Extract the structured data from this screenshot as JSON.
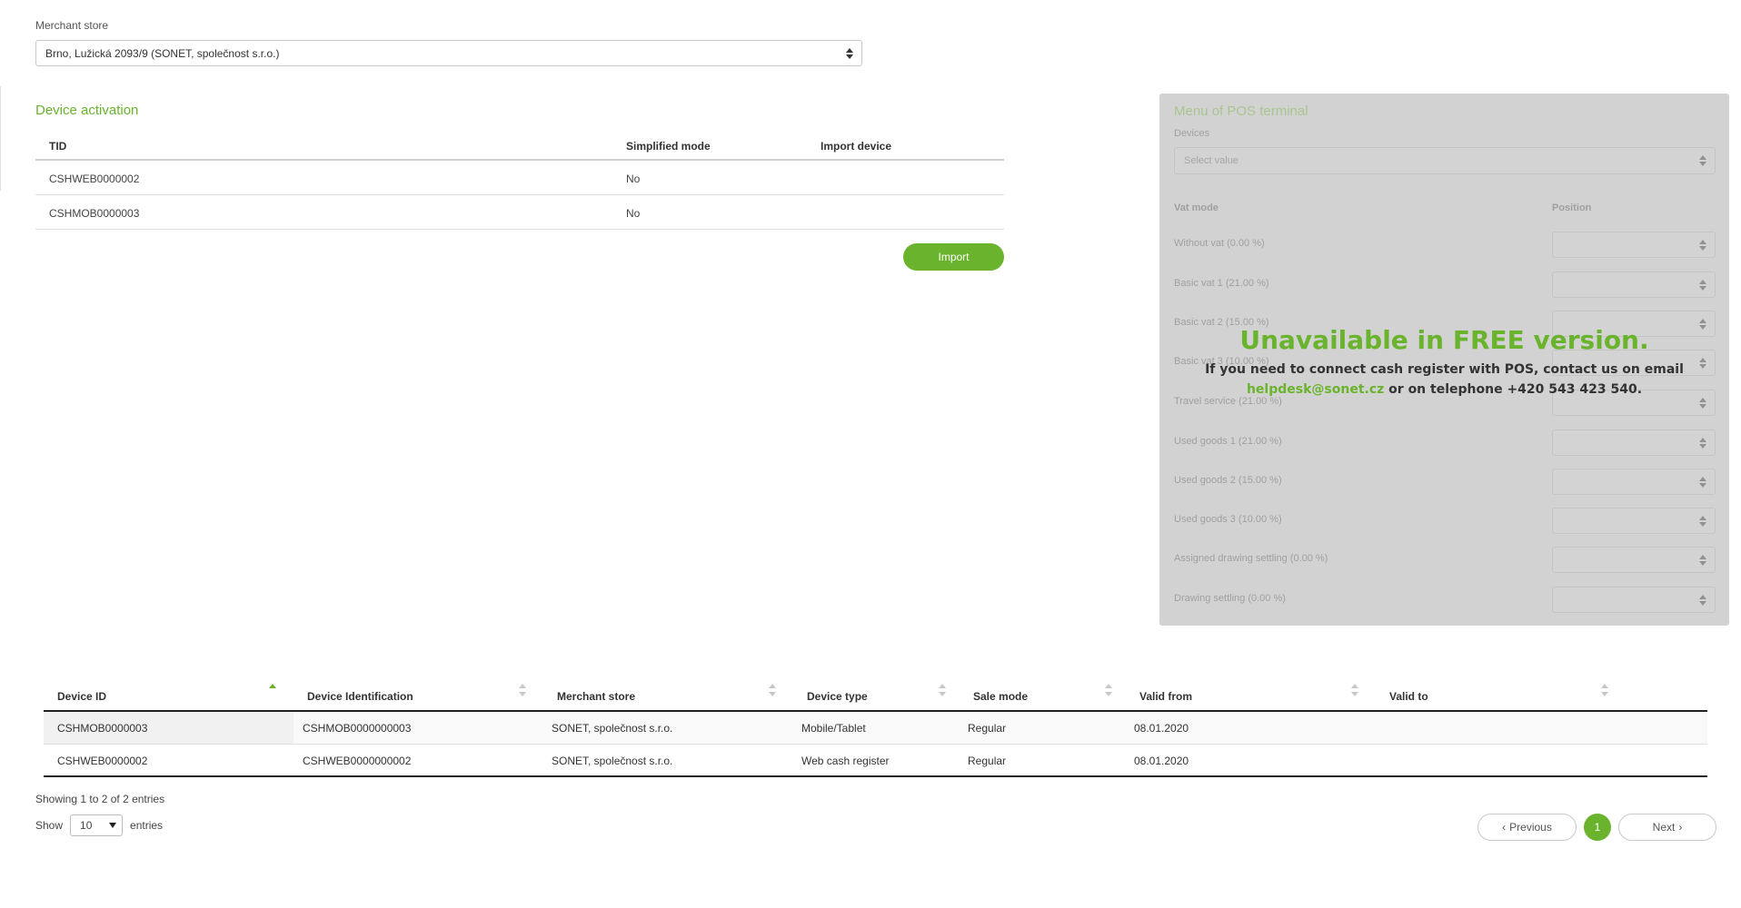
{
  "merchant_store": {
    "label": "Merchant store",
    "selected": "Brno, Lužická 2093/9 (SONET, společnost s.r.o.)"
  },
  "device_activation": {
    "title": "Device activation",
    "columns": [
      "TID",
      "Simplified mode",
      "Import device"
    ],
    "rows": [
      {
        "tid": "CSHWEB0000002",
        "simplified": "No",
        "import": ""
      },
      {
        "tid": "CSHMOB0000003",
        "simplified": "No",
        "import": ""
      }
    ],
    "import_label": "Import"
  },
  "pos_menu": {
    "title": "Menu of POS terminal",
    "devices_label": "Devices",
    "devices_placeholder": "Select value",
    "vat_mode_header": "Vat mode",
    "position_header": "Position",
    "vat_modes": [
      "Without vat (0.00 %)",
      "Basic vat 1 (21.00 %)",
      "Basic vat 2 (15.00 %)",
      "Basic vat 3 (10.00 %)",
      "Travel service (21.00 %)",
      "Used goods 1 (21.00 %)",
      "Used goods 2 (15.00 %)",
      "Used goods 3 (10.00 %)",
      "Assigned drawing settling (0.00 %)",
      "Drawing settling (0.00 %)"
    ],
    "overlay_title": "Unavailable in FREE version.",
    "overlay_line1": "If you need to connect cash register with POS, contact us on email",
    "overlay_email": "helpdesk@sonet.cz",
    "overlay_line2_rest": " or on telephone +420 543 423 540."
  },
  "devices_table": {
    "columns": [
      "Device ID",
      "Device Identification",
      "Merchant store",
      "Device type",
      "Sale mode",
      "Valid from",
      "Valid to"
    ],
    "rows": [
      {
        "device_id": "CSHMOB0000003",
        "identification": "CSHMOB0000000003",
        "store": "SONET, společnost s.r.o.",
        "type": "Mobile/Tablet",
        "sale_mode": "Regular",
        "valid_from": "08.01.2020",
        "valid_to": ""
      },
      {
        "device_id": "CSHWEB0000002",
        "identification": "CSHWEB0000000002",
        "store": "SONET, společnost s.r.o.",
        "type": "Web cash register",
        "sale_mode": "Regular",
        "valid_from": "08.01.2020",
        "valid_to": ""
      }
    ],
    "info": "Showing 1 to 2 of 2 entries",
    "show_label": "Show",
    "page_length": "10",
    "entries_label": "entries",
    "previous_label": "Previous",
    "next_label": "Next",
    "current_page": "1"
  },
  "colors": {
    "accent": "#6ab42d",
    "panel": "#d2d2d2"
  },
  "icons": [
    "select-caret-icon",
    "sort-icon",
    "chevron-left-icon",
    "chevron-right-icon"
  ]
}
